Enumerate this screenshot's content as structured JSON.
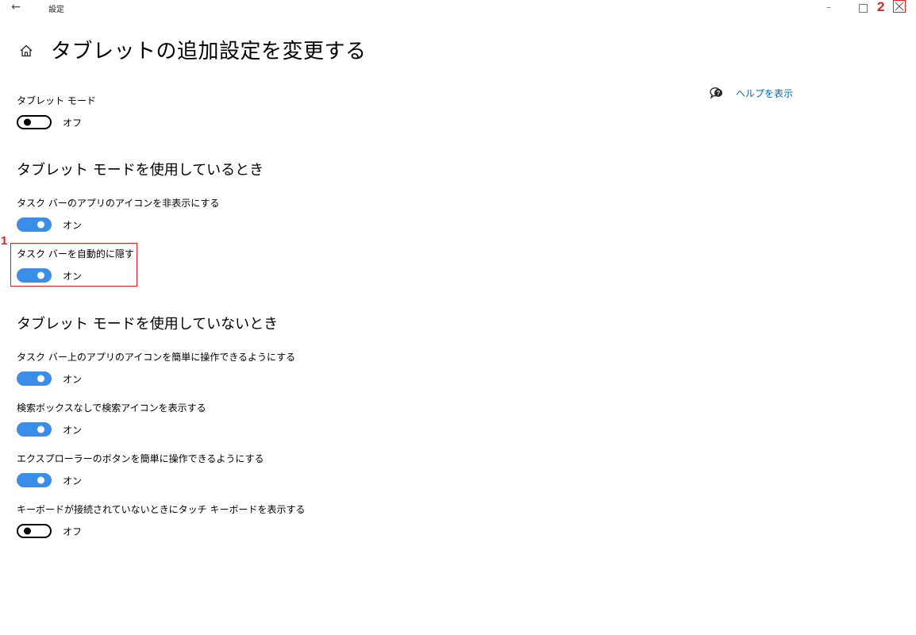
{
  "window": {
    "title": "設定",
    "back_glyph": "←",
    "minimize_glyph": "–"
  },
  "annotations": {
    "step1": "1",
    "step2": "2",
    "accent_color": "#e02020"
  },
  "page": {
    "title": "タブレットの追加設定を変更する",
    "help_link": "ヘルプを表示"
  },
  "tablet_mode": {
    "label": "タブレット モード",
    "state": "オフ",
    "on": false
  },
  "section_using": {
    "heading": "タブレット モードを使用しているとき",
    "settings": [
      {
        "label": "タスク バーのアプリのアイコンを非表示にする",
        "state": "オン",
        "on": true
      },
      {
        "label": "タスク バーを自動的に隠す",
        "state": "オン",
        "on": true
      }
    ]
  },
  "section_not_using": {
    "heading": "タブレット モードを使用していないとき",
    "settings": [
      {
        "label": "タスク バー上のアプリのアイコンを簡単に操作できるようにする",
        "state": "オン",
        "on": true
      },
      {
        "label": "検索ボックスなしで検索アイコンを表示する",
        "state": "オン",
        "on": true
      },
      {
        "label": "エクスプローラーのボタンを簡単に操作できるようにする",
        "state": "オン",
        "on": true
      },
      {
        "label": "キーボードが接続されていないときにタッチ キーボードを表示する",
        "state": "オフ",
        "on": false
      }
    ]
  },
  "colors": {
    "toggle_on": "#3b8ee8",
    "link": "#0067b8"
  }
}
